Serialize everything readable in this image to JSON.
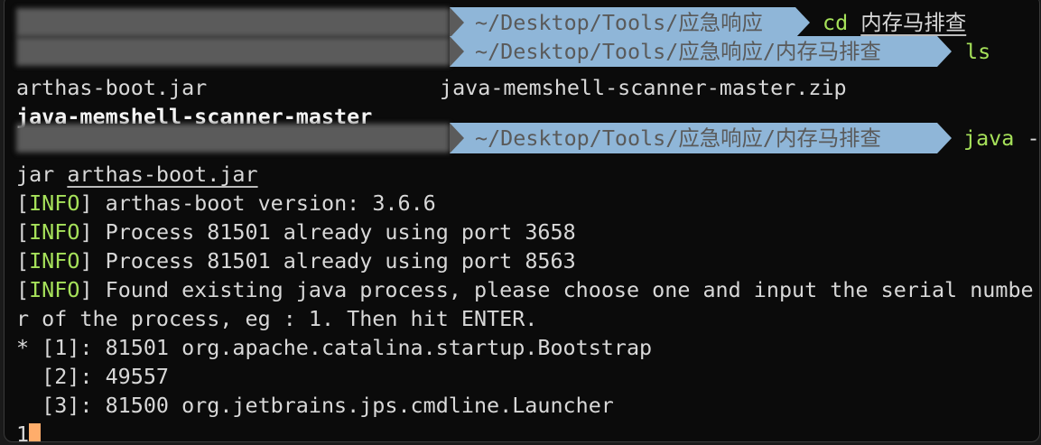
{
  "prompts": [
    {
      "path": "~/Desktop/Tools/应急响应",
      "command": "cd",
      "arg": "内存马排查"
    },
    {
      "path": "~/Desktop/Tools/应急响应/内存马排查",
      "command": "ls",
      "arg": ""
    },
    {
      "path": "~/Desktop/Tools/应急响应/内存马排查",
      "command": "java",
      "arg": "-"
    }
  ],
  "ls_output": {
    "file1": "arthas-boot.jar",
    "file2": "java-memshell-scanner-master.zip",
    "dir1": "java-memshell-scanner-master"
  },
  "wrap_line": {
    "prefix": "jar ",
    "arg": "arthas-boot.jar"
  },
  "info": {
    "tag": "INFO",
    "lines": [
      "arthas-boot version: 3.6.6",
      "Process 81501 already using port 3658",
      "Process 81501 already using port 8563",
      "Found existing java process, please choose one and input the serial numbe"
    ],
    "continuation": "r of the process, eg : 1. Then hit ENTER."
  },
  "processes": [
    "* [1]: 81501 org.apache.catalina.startup.Bootstrap",
    "  [2]: 49557",
    "  [3]: 81500 org.jetbrains.jps.cmdline.Launcher"
  ],
  "input": "1",
  "colors": {
    "path_bg": "#8fb6d8",
    "command": "#a6e15a",
    "cursor": "#ffad6b",
    "background": "#0b0b0b"
  }
}
